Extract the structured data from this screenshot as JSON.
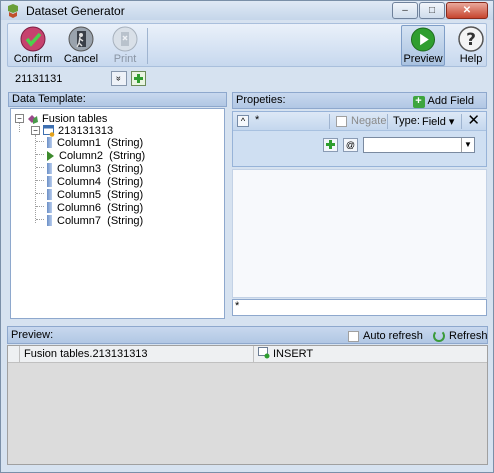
{
  "window": {
    "title": "Dataset Generator",
    "controls": {
      "minimize": "–",
      "maximize": "□",
      "close": "✕"
    }
  },
  "toolbar": {
    "confirm_label": "Confirm",
    "cancel_label": "Cancel",
    "print_label": "Print",
    "preview_label": "Preview",
    "help_label": "Help"
  },
  "dataset": {
    "value": "21131131",
    "drop_glyph": "»"
  },
  "data_template": {
    "header": "Data Template:",
    "root": "Fusion tables",
    "table": "213131313",
    "columns": [
      {
        "name": "Column1",
        "type": "(String)"
      },
      {
        "name": "Column2",
        "type": "(String)"
      },
      {
        "name": "Column3",
        "type": "(String)"
      },
      {
        "name": "Column4",
        "type": "(String)"
      },
      {
        "name": "Column5",
        "type": "(String)"
      },
      {
        "name": "Column6",
        "type": "(String)"
      },
      {
        "name": "Column7",
        "type": "(String)"
      }
    ]
  },
  "properties": {
    "header": "Propeties:",
    "add_field_label": "Add Field",
    "star": "*",
    "negate_label": "Negate",
    "type_label": "Type:",
    "type_value": "Field ▾",
    "field_value": "",
    "expression": "*"
  },
  "preview": {
    "header": "Preview:",
    "auto_refresh_label": "Auto refresh",
    "refresh_label": "Refresh",
    "row": {
      "table": "Fusion tables.213131313",
      "action": "INSERT"
    }
  }
}
